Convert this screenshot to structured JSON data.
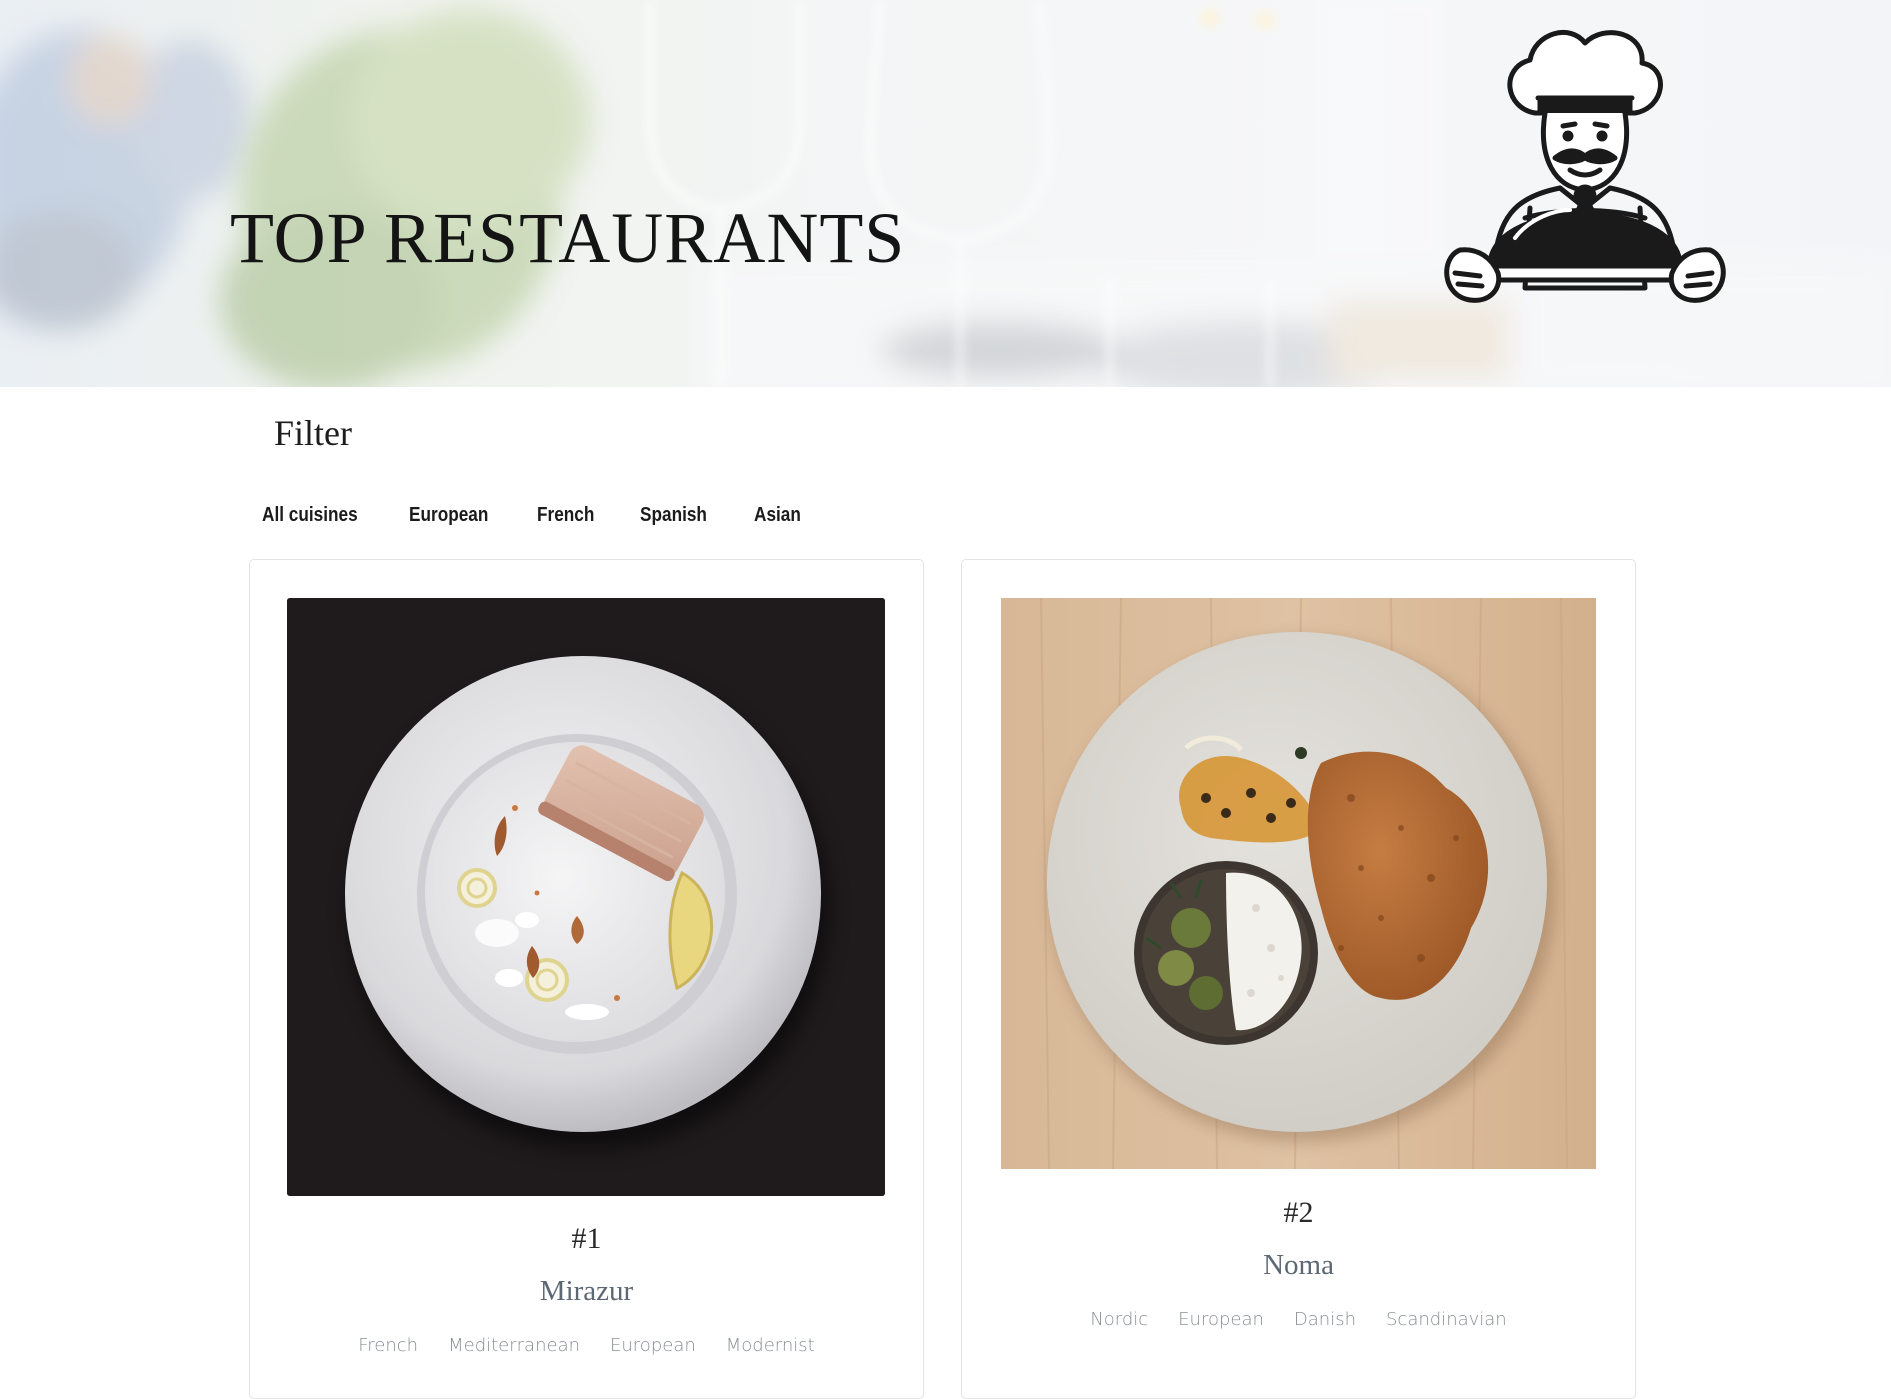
{
  "header": {
    "title": "TOP RESTAURANTS",
    "logo_icon": "chef-holding-cloche-icon",
    "background": "blurred-dining-table-photo"
  },
  "filter": {
    "heading": "Filter",
    "options": [
      {
        "label": "All cuisines"
      },
      {
        "label": "European"
      },
      {
        "label": "French"
      },
      {
        "label": "Spanish"
      },
      {
        "label": "Asian"
      }
    ]
  },
  "restaurants": [
    {
      "rank": "#1",
      "name": "Mirazur",
      "image": "plated-fish-dish-photo",
      "tags": [
        "French",
        "Mediterranean",
        "European",
        "Modernist"
      ]
    },
    {
      "rank": "#2",
      "name": "Noma",
      "image": "schnitzel-plate-photo",
      "tags": [
        "Nordic",
        "European",
        "Danish",
        "Scandinavian"
      ]
    }
  ],
  "colors": {
    "title_text": "#141414",
    "restaurant_name": "#5d6875",
    "tag_text": "#8a8f96",
    "card_border": "#e3e3e3"
  }
}
